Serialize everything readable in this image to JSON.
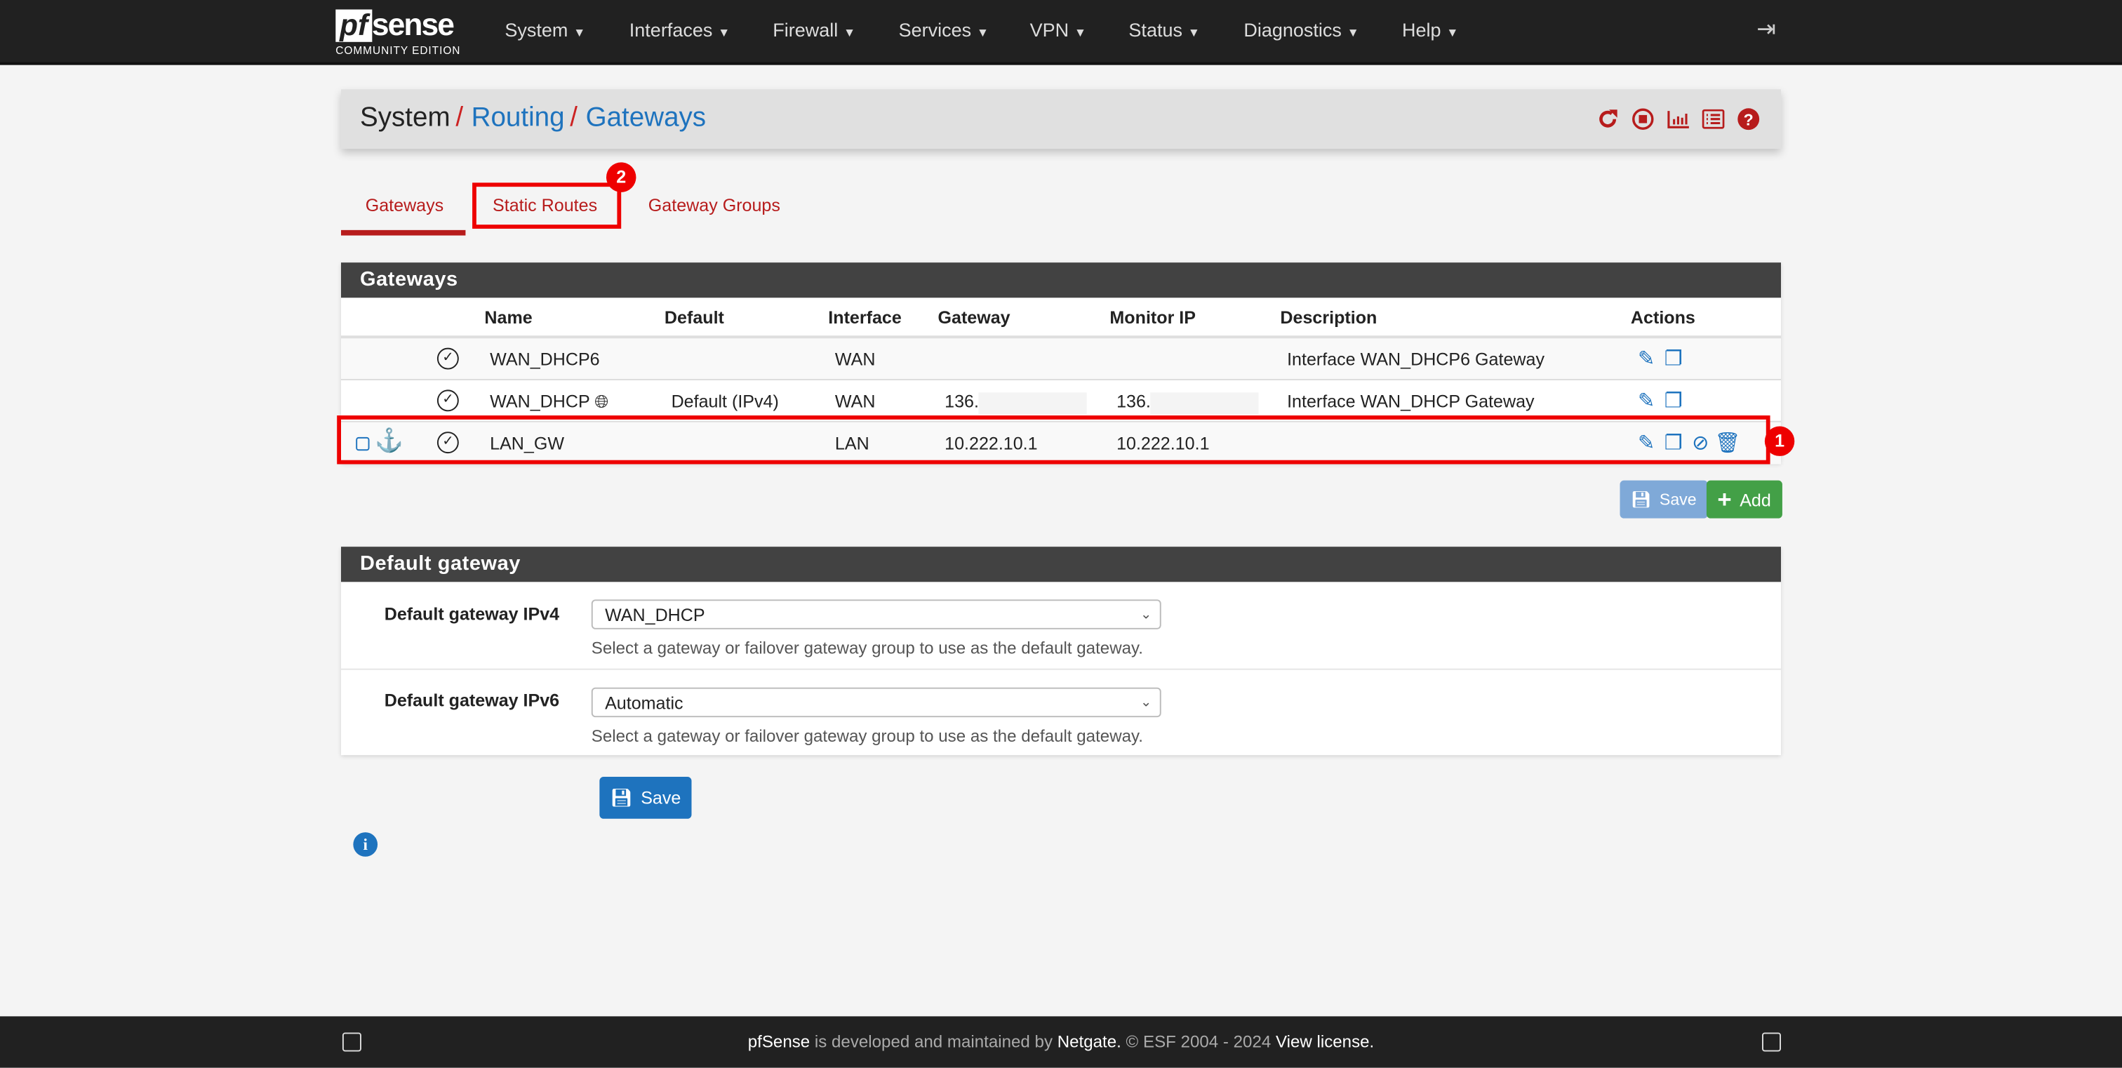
{
  "nav": {
    "logo_pf": "pf",
    "logo_sense": "sense",
    "logo_edition": "COMMUNITY EDITION",
    "menus": [
      "System",
      "Interfaces",
      "Firewall",
      "Services",
      "VPN",
      "Status",
      "Diagnostics",
      "Help"
    ]
  },
  "breadcrumb": {
    "root": "System",
    "section": "Routing",
    "page": "Gateways"
  },
  "tabs": [
    "Gateways",
    "Static Routes",
    "Gateway Groups"
  ],
  "annotations": {
    "row_badge": "1",
    "tab_badge": "2"
  },
  "gateways": {
    "title": "Gateways",
    "columns": [
      "Name",
      "Default",
      "Interface",
      "Gateway",
      "Monitor IP",
      "Description",
      "Actions"
    ],
    "rows": [
      {
        "name": "WAN_DHCP6",
        "default": "",
        "interface": "WAN",
        "gateway": "",
        "monitor": "",
        "description": "Interface WAN_DHCP6 Gateway"
      },
      {
        "name": "WAN_DHCP",
        "default": "Default (IPv4)",
        "interface": "WAN",
        "gateway": "136.",
        "monitor": "136.",
        "description": "Interface WAN_DHCP Gateway"
      },
      {
        "name": "LAN_GW",
        "default": "",
        "interface": "LAN",
        "gateway": "10.222.10.1",
        "monitor": "10.222.10.1",
        "description": ""
      }
    ],
    "save_label": "Save",
    "add_label": "Add"
  },
  "default_gateway": {
    "title": "Default gateway",
    "ipv4_label": "Default gateway IPv4",
    "ipv4_value": "WAN_DHCP",
    "ipv6_label": "Default gateway IPv6",
    "ipv6_value": "Automatic",
    "help": "Select a gateway or failover gateway group to use as the default gateway.",
    "save_label": "Save"
  },
  "footer": {
    "brand": "pfSense",
    "text1": " is developed and maintained by ",
    "company": "Netgate.",
    "text2": " © ESF 2004 - 2024 ",
    "license": "View license."
  },
  "colors": {
    "accent_red": "#b71c1c",
    "link_blue": "#1e73be",
    "add_green": "#43a047"
  }
}
